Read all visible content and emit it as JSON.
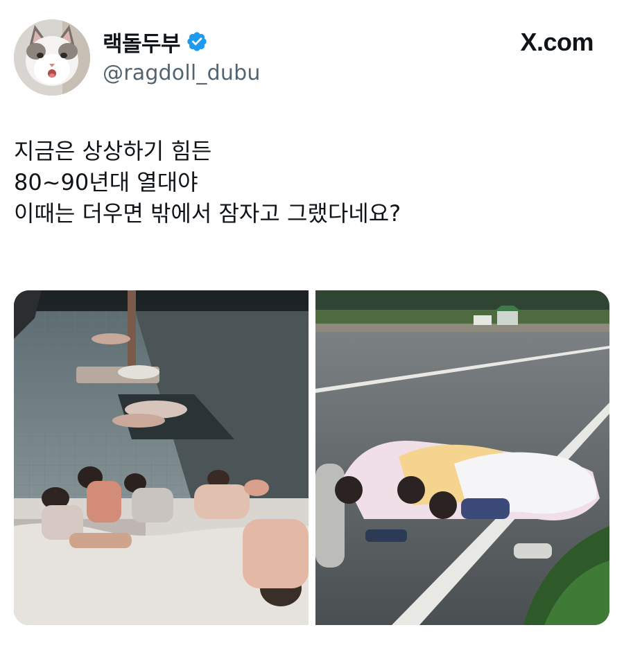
{
  "author": {
    "display_name": "랙돌두부",
    "handle": "@ragdoll_dubu",
    "verified": true,
    "avatar_icon": "white-cat-avatar"
  },
  "site": {
    "logo_text": "X.com"
  },
  "tweet": {
    "lines": [
      "지금은 상상하기 힘든",
      "80~90년대 열대야",
      "이때는 더우면 밖에서 잠자고 그랬다네요?"
    ]
  },
  "media": {
    "photos": [
      {
        "subject": "children sleeping on a tiled sidewalk at night"
      },
      {
        "subject": "children sleeping under blankets beside a road at dawn"
      }
    ]
  },
  "colors": {
    "text": "#0f1419",
    "secondary_text": "#536471",
    "verified_badge": "#1d9bf0",
    "background": "#ffffff"
  }
}
